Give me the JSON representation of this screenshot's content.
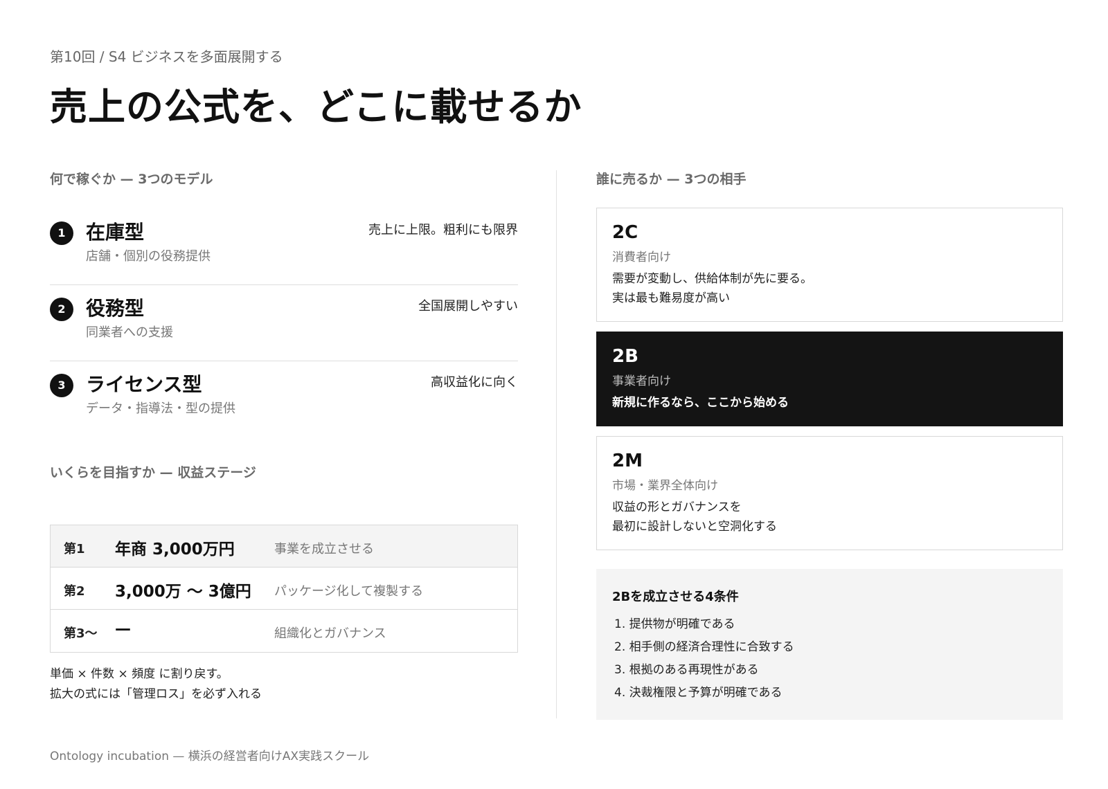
{
  "header": {
    "eyebrow": "第10回 / S4 ビジネスを多面展開する",
    "title": "売上の公式を、どこに載せるか"
  },
  "models": {
    "heading": "何で稼ぐか — 3つのモデル",
    "items": [
      {
        "num": "1",
        "name": "在庫型",
        "sub": "店舗・個別の役務提供",
        "note": "売上に上限。粗利にも限界"
      },
      {
        "num": "2",
        "name": "役務型",
        "sub": "同業者への支援",
        "note": "全国展開しやすい"
      },
      {
        "num": "3",
        "name": "ライセンス型",
        "sub": "データ・指導法・型の提供",
        "note": "高収益化に向く"
      }
    ]
  },
  "stages": {
    "heading": "いくらを目指すか — 収益ステージ",
    "rows": [
      {
        "label": "第1",
        "amount": "年商 3,000万円",
        "desc": "事業を成立させる"
      },
      {
        "label": "第2",
        "amount": "3,000万 〜 3億円",
        "desc": "パッケージ化して複製する"
      },
      {
        "label": "第3〜",
        "amount": "—",
        "desc": "組織化とガバナンス"
      }
    ],
    "formula_line1": "単価 × 件数 × 頻度 に割り戻す。",
    "formula_line2": "拡大の式には「管理ロス」を必ず入れる"
  },
  "customers": {
    "heading": "誰に売るか — 3つの相手",
    "cards": [
      {
        "code": "2C",
        "sub": "消費者向け",
        "desc_line1": "需要が変動し、供給体制が先に要る。",
        "desc_line2": "実は最も難易度が高い"
      },
      {
        "code": "2B",
        "sub": "事業者向け",
        "desc_line1": "新規に作るなら、ここから始める",
        "desc_line2": ""
      },
      {
        "code": "2M",
        "sub": "市場・業界全体向け",
        "desc_line1": "収益の形とガバナンスを",
        "desc_line2": "最初に設計しないと空洞化する"
      }
    ]
  },
  "conditions": {
    "title": "2Bを成立させる4条件",
    "items": [
      "1. 提供物が明確である",
      "2. 相手側の経済合理性に合致する",
      "3. 根拠のある再現性がある",
      "4. 決裁権限と予算が明確である"
    ]
  },
  "footer": {
    "text": "Ontology incubation — 横浜の経営者向けAX実践スクール"
  }
}
